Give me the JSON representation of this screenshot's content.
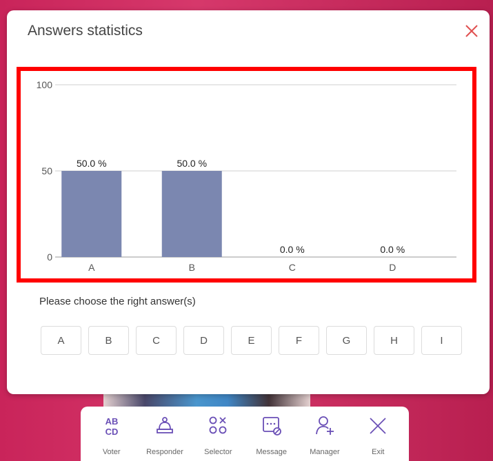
{
  "dialog": {
    "title": "Answers statistics",
    "prompt": "Please choose the right answer(s)",
    "answer_options": [
      "A",
      "B",
      "C",
      "D",
      "E",
      "F",
      "G",
      "H",
      "I"
    ]
  },
  "chart_data": {
    "type": "bar",
    "categories": [
      "A",
      "B",
      "C",
      "D"
    ],
    "values": [
      50.0,
      50.0,
      0.0,
      0.0
    ],
    "data_labels": [
      "50.0 %",
      "50.0 %",
      "0.0 %",
      "0.0 %"
    ],
    "yticks": [
      "100",
      "50",
      "0"
    ],
    "ylim": [
      0,
      100
    ],
    "grid": true,
    "bar_color": "#7b87b0"
  },
  "toolbar": {
    "items": [
      {
        "label": "Voter",
        "icon": "voter-icon"
      },
      {
        "label": "Responder",
        "icon": "bell-icon"
      },
      {
        "label": "Selector",
        "icon": "selector-icon"
      },
      {
        "label": "Message",
        "icon": "message-icon"
      },
      {
        "label": "Manager",
        "icon": "add-user-icon"
      },
      {
        "label": "Exit",
        "icon": "close-icon"
      }
    ]
  },
  "colors": {
    "accent": "#6a4fb6",
    "close": "#e05050",
    "highlight": "#ff0000",
    "background": "#c9245a"
  }
}
